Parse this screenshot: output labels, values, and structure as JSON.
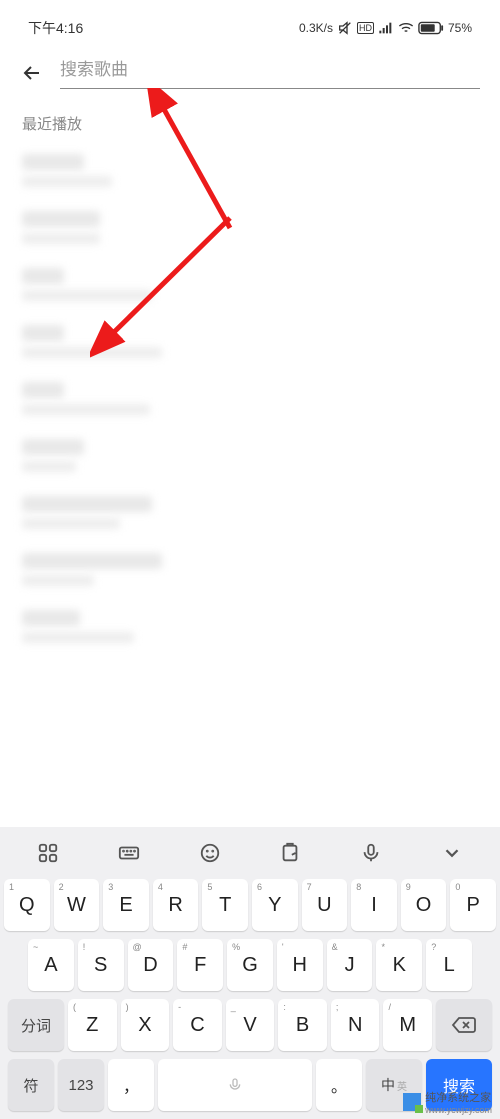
{
  "status": {
    "time": "下午4:16",
    "speed": "0.3K/s",
    "battery": "75%"
  },
  "search": {
    "placeholder": "搜索歌曲"
  },
  "section_title": "最近播放",
  "songs": [
    {
      "tw": 62,
      "sw": 90
    },
    {
      "tw": 78,
      "sw": 78
    },
    {
      "tw": 42,
      "sw": 130
    },
    {
      "tw": 42,
      "sw": 140
    },
    {
      "tw": 42,
      "sw": 128
    },
    {
      "tw": 62,
      "sw": 54
    },
    {
      "tw": 130,
      "sw": 98
    },
    {
      "tw": 140,
      "sw": 72
    },
    {
      "tw": 58,
      "sw": 112
    }
  ],
  "keyboard": {
    "row1": [
      {
        "sup": "1",
        "main": "Q"
      },
      {
        "sup": "2",
        "main": "W"
      },
      {
        "sup": "3",
        "main": "E"
      },
      {
        "sup": "4",
        "main": "R"
      },
      {
        "sup": "5",
        "main": "T"
      },
      {
        "sup": "6",
        "main": "Y"
      },
      {
        "sup": "7",
        "main": "U"
      },
      {
        "sup": "8",
        "main": "I"
      },
      {
        "sup": "9",
        "main": "O"
      },
      {
        "sup": "0",
        "main": "P"
      }
    ],
    "row2": [
      {
        "sup": "~",
        "main": "A"
      },
      {
        "sup": "!",
        "main": "S"
      },
      {
        "sup": "@",
        "main": "D"
      },
      {
        "sup": "#",
        "main": "F"
      },
      {
        "sup": "%",
        "main": "G"
      },
      {
        "sup": "'",
        "main": "H"
      },
      {
        "sup": "&",
        "main": "J"
      },
      {
        "sup": "*",
        "main": "K"
      },
      {
        "sup": "?",
        "main": "L"
      }
    ],
    "row3": [
      {
        "sup": "(",
        "main": "Z"
      },
      {
        "sup": ")",
        "main": "X"
      },
      {
        "sup": "-",
        "main": "C"
      },
      {
        "sup": "_",
        "main": "V"
      },
      {
        "sup": ":",
        "main": "B"
      },
      {
        "sup": ";",
        "main": "N"
      },
      {
        "sup": "/",
        "main": "M"
      }
    ],
    "fenci": "分词",
    "fu": "符",
    "num": "123",
    "comma": "，",
    "period": "。",
    "lang_main": "中",
    "lang_sub": "英",
    "search": "搜索"
  },
  "watermark": {
    "line1": "纯净系统之家",
    "line2": "www.ycwjzy.com"
  }
}
